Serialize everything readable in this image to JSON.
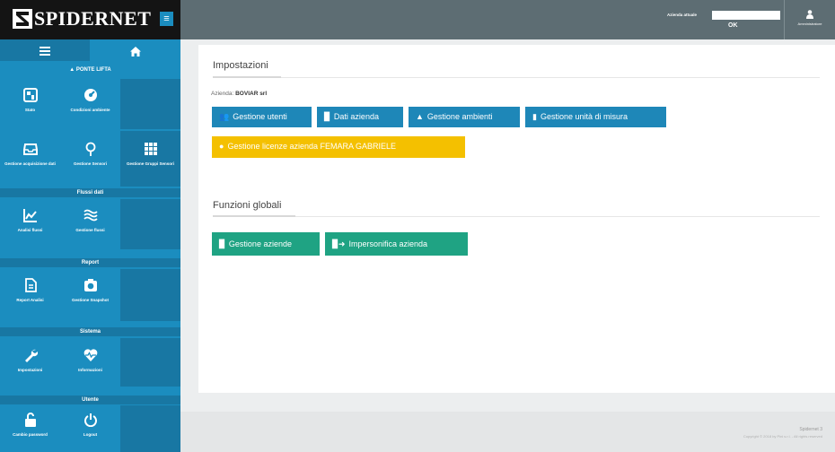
{
  "logo": {
    "text": "SPIDERNET",
    "menu_glyph": "≡"
  },
  "sidebar": {
    "menu_icon": "hamburger-icon",
    "home_icon": "home-icon",
    "sections": [
      {
        "title": "▲ PONTE LIFTA"
      },
      {
        "title": "Flussi dati"
      },
      {
        "title": "Report"
      },
      {
        "title": "Sistema"
      },
      {
        "title": "Utente"
      }
    ],
    "tiles": [
      {
        "label": "Stato",
        "icon": "dashboard-icon"
      },
      {
        "label": "Condizioni ambiente",
        "icon": "speedometer-icon"
      },
      {
        "label": "Gestione acquisizione dati",
        "icon": "tray-icon"
      },
      {
        "label": "Gestione Sensori",
        "icon": "map-pin-icon"
      },
      {
        "label": "Gestione Gruppi Sensori",
        "icon": "grid-icon"
      },
      {
        "label": "Analisi flussi",
        "icon": "line-chart-icon"
      },
      {
        "label": "Gestione flussi",
        "icon": "waves-icon"
      },
      {
        "label": "Report Analisi",
        "icon": "report-icon"
      },
      {
        "label": "Gestione Snapshot",
        "icon": "camera-icon"
      },
      {
        "label": "Impostazioni",
        "icon": "wrench-icon"
      },
      {
        "label": "Informazioni",
        "icon": "heartbeat-icon"
      },
      {
        "label": "Cambio password",
        "icon": "unlock-icon"
      },
      {
        "label": "Logout",
        "icon": "power-icon"
      }
    ]
  },
  "topbar": {
    "azienda_label": "Azienda attuale",
    "azienda_ok": "OK",
    "user_label": "Amministratore"
  },
  "main": {
    "section1": {
      "title": "Impostazioni"
    },
    "azienda_prefix": "Azienda:",
    "azienda_name": "BOVIAR srl",
    "buttons_row1": [
      {
        "label": "Gestione utenti",
        "icon": "users-icon",
        "glyph": "👥"
      },
      {
        "label": "Dati azienda",
        "icon": "building-icon",
        "glyph": "▉"
      },
      {
        "label": "Gestione ambienti",
        "icon": "mountain-icon",
        "glyph": "▲"
      },
      {
        "label": "Gestione unità di misura",
        "icon": "measure-icon",
        "glyph": "▮"
      }
    ],
    "license_button": {
      "label": "Gestione licenze azienda FEMARA GABRIELE",
      "icon": "circle-icon",
      "glyph": "●"
    },
    "section2": {
      "title": "Funzioni globali"
    },
    "buttons_global": [
      {
        "label": "Gestione aziende",
        "icon": "building-icon",
        "glyph": "▉"
      },
      {
        "label": "Impersonifica azienda",
        "icon": "impersonate-icon",
        "glyph": "▉➜"
      }
    ]
  },
  "footer": {
    "version": "Spidernet 3",
    "copyright": "Copyright © 2018 by Pini s.r.l. - All rights reserved"
  },
  "colors": {
    "sidebar": "#1b8dbf",
    "topbar": "#5d6d73",
    "blue_button": "#1e87b8",
    "yellow_button": "#f4c000",
    "green_button": "#1fa383"
  }
}
